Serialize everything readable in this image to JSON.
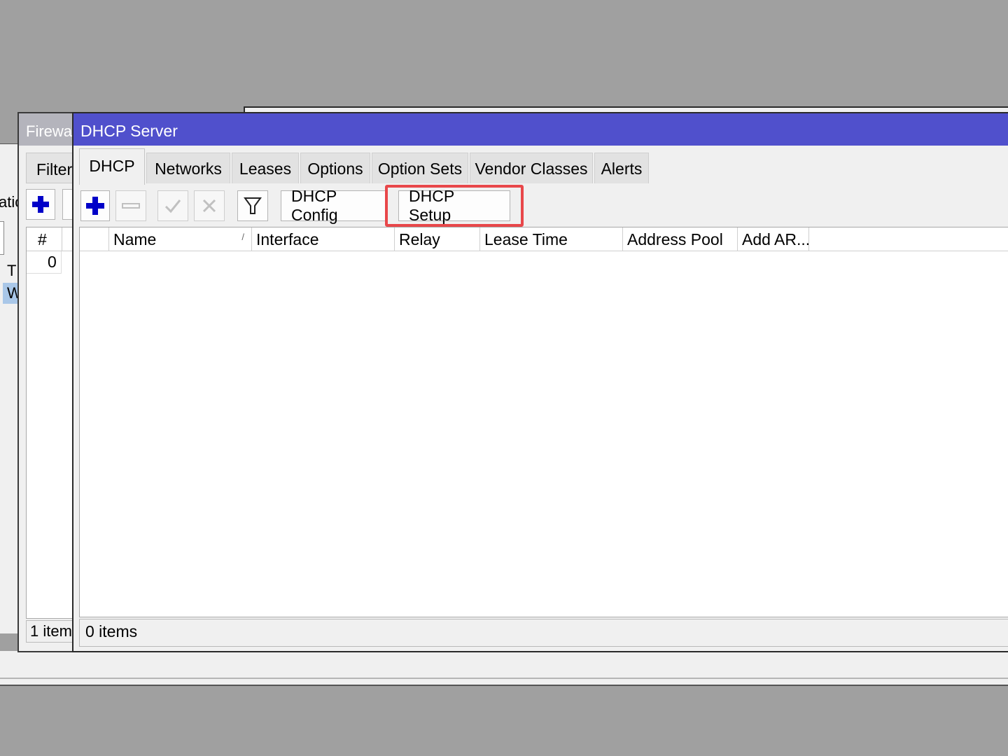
{
  "firewall_window": {
    "title": "Firewa",
    "tab": "Filter",
    "column_header": "#",
    "row_value": "0",
    "status": "1 item"
  },
  "background_window": {
    "left_text": "atic",
    "row1": "T",
    "row2": "W"
  },
  "dhcp_window": {
    "title": "DHCP Server",
    "tabs": [
      "DHCP",
      "Networks",
      "Leases",
      "Options",
      "Option Sets",
      "Vendor Classes",
      "Alerts"
    ],
    "active_tab": "DHCP",
    "toolbar": {
      "config_label": "DHCP Config",
      "setup_label": "DHCP Setup"
    },
    "columns": [
      "Name",
      "Interface",
      "Relay",
      "Lease Time",
      "Address Pool",
      "Add AR..."
    ],
    "sort_indicator": "/",
    "status": "0 items"
  },
  "colors": {
    "title_bar_active": "#5050cc",
    "highlight_border": "#e8474a",
    "add_icon": "#0000c8"
  }
}
